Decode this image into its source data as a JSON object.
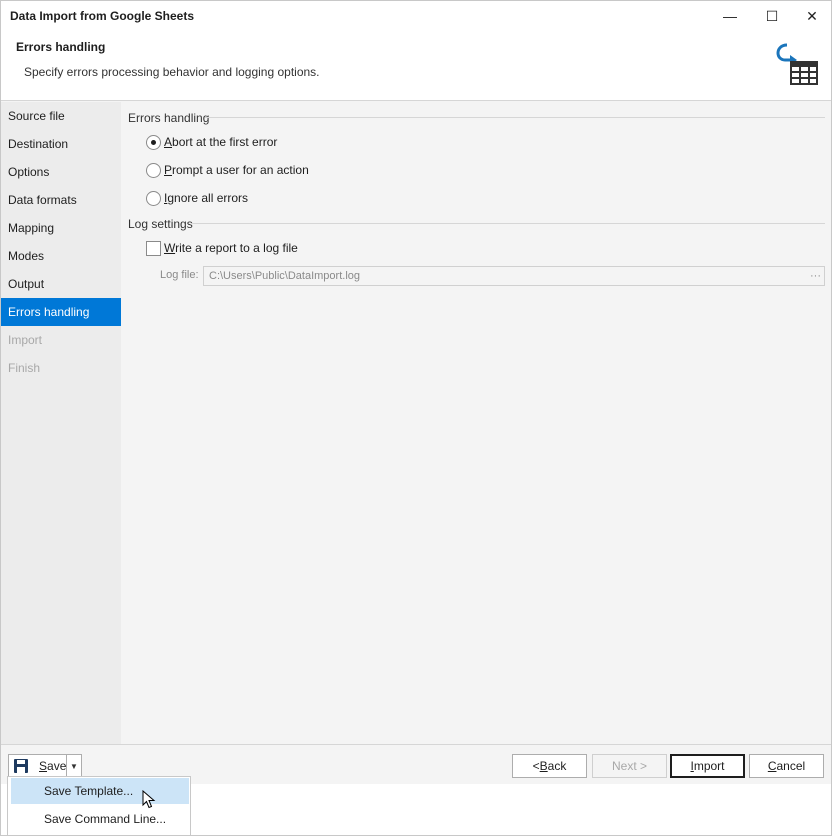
{
  "window": {
    "title": "Data Import from Google Sheets",
    "min_glyph": "—",
    "max_glyph": "☐",
    "close_glyph": "✕"
  },
  "header": {
    "title": "Errors handling",
    "description": "Specify errors processing behavior and logging options.",
    "icon": "import-to-table-icon"
  },
  "nav": {
    "items": [
      {
        "label": "Source file",
        "state": "normal"
      },
      {
        "label": "Destination",
        "state": "normal"
      },
      {
        "label": "Options",
        "state": "normal"
      },
      {
        "label": "Data formats",
        "state": "normal"
      },
      {
        "label": "Mapping",
        "state": "normal"
      },
      {
        "label": "Modes",
        "state": "normal"
      },
      {
        "label": "Output",
        "state": "normal"
      },
      {
        "label": "Errors handling",
        "state": "selected"
      },
      {
        "label": "Import",
        "state": "disabled"
      },
      {
        "label": "Finish",
        "state": "disabled"
      }
    ]
  },
  "errors_group": {
    "label": "Errors handling",
    "options": [
      {
        "hotkey": "A",
        "rest": "bort at the first error",
        "checked": true
      },
      {
        "hotkey": "P",
        "rest": "rompt a user for an action",
        "checked": false
      },
      {
        "hotkey": "I",
        "rest": "gnore all errors",
        "checked": false
      }
    ]
  },
  "log_group": {
    "label": "Log settings",
    "checkbox_hotkey": "W",
    "checkbox_rest": "rite a report to a log file",
    "checked": false,
    "logfile_label": "Log file:",
    "logfile_value": "C:\\Users\\Public\\DataImport.log",
    "browse_glyph": "···"
  },
  "footer": {
    "save_hotkey": "S",
    "save_rest": "ave",
    "dropdown_glyph": "▼",
    "back_prefix": "< ",
    "back_hotkey": "B",
    "back_rest": "ack",
    "next_label": "Next >",
    "import_hotkey": "I",
    "import_rest": "mport",
    "cancel_hotkey": "C",
    "cancel_rest": "ancel"
  },
  "save_menu": {
    "items": [
      {
        "label": "Save Template...",
        "hover": true
      },
      {
        "label": "Save Command Line...",
        "hover": false
      }
    ]
  },
  "colors": {
    "accent": "#0078d7",
    "icon_blue": "#1b75bb",
    "icon_dark": "#333333"
  }
}
